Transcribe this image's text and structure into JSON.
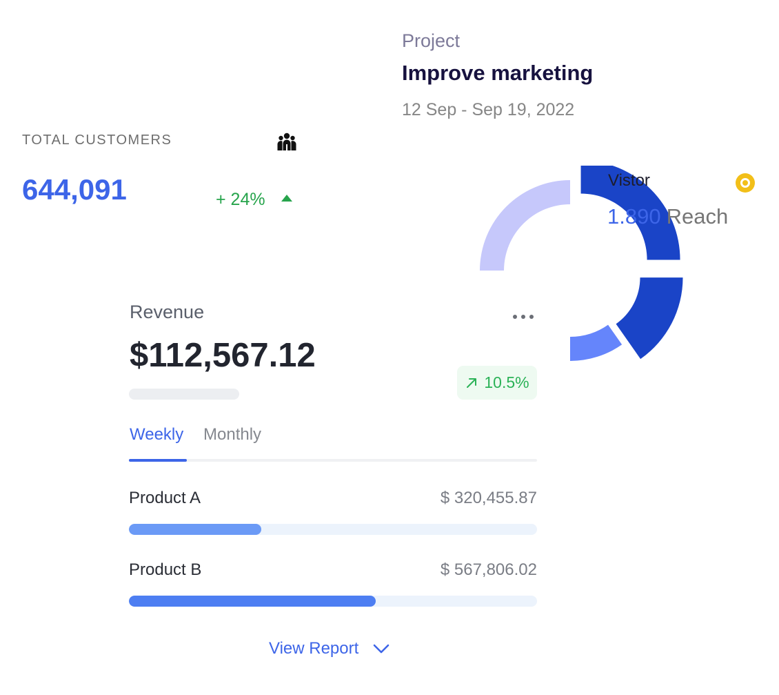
{
  "project": {
    "eyebrow": "Project",
    "title": "Improve marketing",
    "dates": "12 Sep - Sep 19, 2022"
  },
  "customers": {
    "label": "TOTAL CUSTOMERS",
    "value": "644,091",
    "change": "+ 24%",
    "icon": "users-icon",
    "trend_icon": "triangle-up-icon",
    "trend_color": "#27a44c"
  },
  "visitor": {
    "label": "Vistor",
    "number": "1.890",
    "unit": "Reach",
    "icon": "eye-icon",
    "icon_color": "#f2bf19"
  },
  "chart_data": {
    "type": "pie",
    "style": "donut",
    "segments": [
      {
        "value": 25,
        "color": "#c6c8fb"
      },
      {
        "value": 8,
        "color": "#1a44c7"
      },
      {
        "value": 23,
        "color": "#1a44c7"
      },
      {
        "value": 10,
        "color": "#6585fb"
      }
    ]
  },
  "revenue": {
    "label": "Revenue",
    "value": "$112,567.12",
    "change": "10.5%",
    "more_icon": "more-horizontal-icon",
    "trend_icon": "arrow-up-right-icon",
    "trend_color": "#2bb257"
  },
  "tabs": [
    {
      "label": "Weekly",
      "active": true
    },
    {
      "label": "Monthly",
      "active": false
    }
  ],
  "products": [
    {
      "name": "Product A",
      "amount": "$ 320,455.87",
      "progress": 0.325,
      "color": "#6b9af6"
    },
    {
      "name": "Product B",
      "amount": "$ 567,806.02",
      "progress": 0.605,
      "color": "#4d7ef2"
    }
  ],
  "footer": {
    "view_report_label": "View Report",
    "chevron_icon": "chevron-down-icon"
  },
  "colors": {
    "accent": "#3d65e8",
    "title": "#17123f",
    "track": "#ecf3fc"
  }
}
